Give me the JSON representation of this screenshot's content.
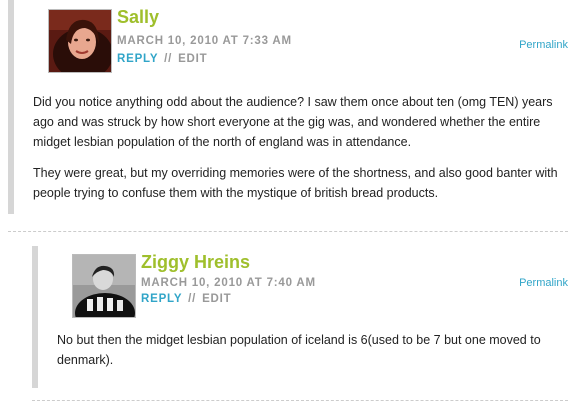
{
  "comments": [
    {
      "author": "Sally",
      "date": "MARCH 10, 2010 AT 7:33 AM",
      "reply_label": "REPLY",
      "separator": "//",
      "edit_label": "EDIT",
      "permalink_label": "Permalink",
      "paragraphs": [
        "Did you notice anything odd about the audience? I saw them once about ten (omg TEN) years ago and was struck by how short everyone at the gig was, and wondered whether the entire midget lesbian population of the north of england was in attendance.",
        "They were great, but my overriding memories were of the shortness, and also good banter with people trying to confuse them with the mystique of british bread products."
      ]
    },
    {
      "author": "Ziggy Hreins",
      "date": "MARCH 10, 2010 AT 7:40 AM",
      "reply_label": "REPLY",
      "separator": "//",
      "edit_label": "EDIT",
      "permalink_label": "Permalink",
      "paragraphs": [
        "No but then the midget lesbian population of iceland is 6(used to be 7 but one moved to denmark)."
      ]
    }
  ],
  "colors": {
    "author": "#9fbf2c",
    "link": "#31a5c8",
    "meta": "#999999",
    "thread_bar": "#d6d6d6"
  }
}
